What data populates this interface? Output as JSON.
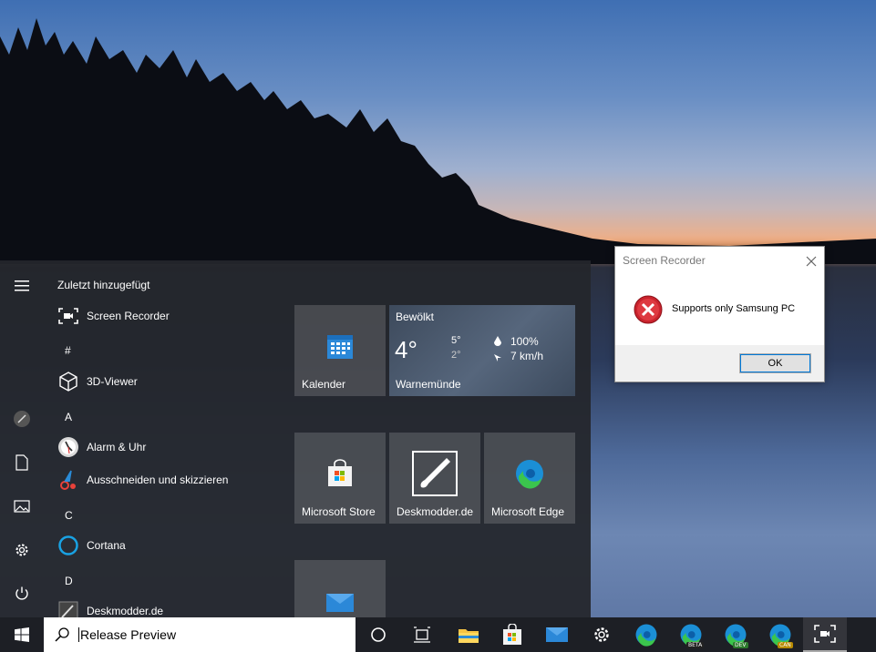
{
  "start_menu": {
    "recent_header": "Zuletzt hinzugefügt",
    "apps": [
      {
        "label": "Screen Recorder"
      },
      {
        "letter": "#"
      },
      {
        "label": "3D-Viewer"
      },
      {
        "letter": "A"
      },
      {
        "label": "Alarm & Uhr"
      },
      {
        "label": "Ausschneiden und skizzieren"
      },
      {
        "letter": "C"
      },
      {
        "label": "Cortana"
      },
      {
        "letter": "D"
      },
      {
        "label": "Deskmodder.de"
      }
    ],
    "tiles": {
      "kalender": "Kalender",
      "store": "Microsoft Store",
      "deskmodder": "Deskmodder.de",
      "edge": "Microsoft Edge"
    },
    "weather": {
      "condition": "Bewölkt",
      "temp": "4°",
      "high": "5°",
      "low": "2°",
      "humidity": "100%",
      "wind": "7 km/h",
      "location": "Warnemünde"
    }
  },
  "dialog": {
    "title": "Screen Recorder",
    "message": "Supports only Samsung PC",
    "ok_label": "OK"
  },
  "taskbar": {
    "search_value": "Release Preview",
    "badges": {
      "beta": "BETA",
      "dev": "DEV",
      "can": "CAN"
    }
  },
  "colors": {
    "accent": "#0078d7",
    "taskbar": "#1d1f25",
    "start_bg": "#24262c"
  }
}
